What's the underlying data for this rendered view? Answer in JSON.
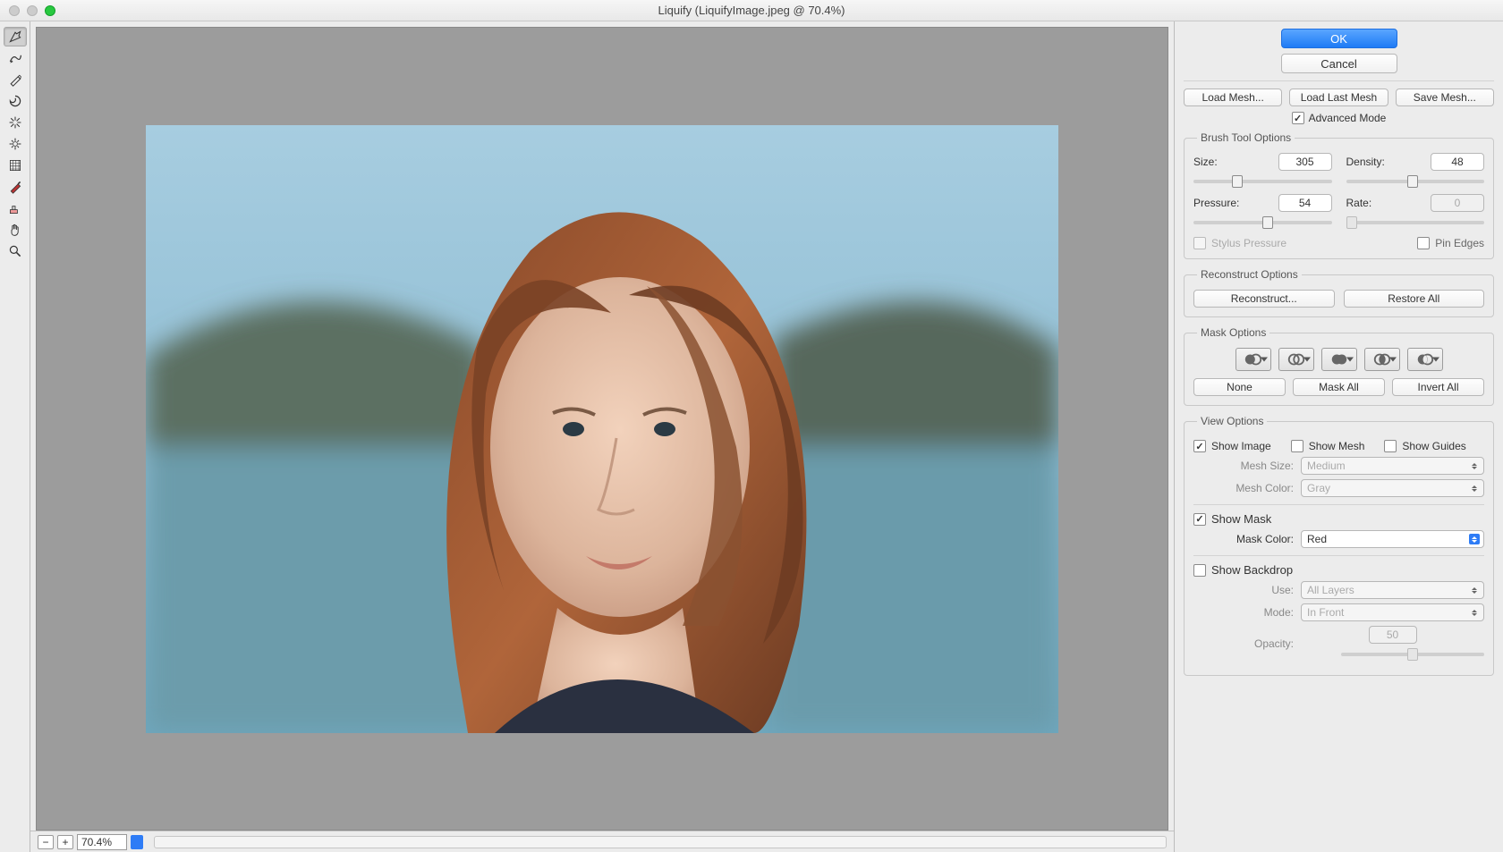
{
  "window": {
    "title": "Liquify (LiquifyImage.jpeg @ 70.4%)"
  },
  "tools": [
    {
      "name": "forward-warp-tool",
      "selected": true
    },
    {
      "name": "reconstruct-tool"
    },
    {
      "name": "smooth-tool"
    },
    {
      "name": "twirl-tool"
    },
    {
      "name": "pucker-tool"
    },
    {
      "name": "bloat-tool"
    },
    {
      "name": "push-left-tool"
    },
    {
      "name": "freeze-mask-tool"
    },
    {
      "name": "thaw-mask-tool"
    },
    {
      "name": "hand-tool"
    },
    {
      "name": "zoom-tool"
    }
  ],
  "status": {
    "zoom": "70.4%"
  },
  "actions": {
    "ok": "OK",
    "cancel": "Cancel"
  },
  "mesh": {
    "load": "Load Mesh...",
    "load_last": "Load Last Mesh",
    "save": "Save Mesh..."
  },
  "advanced": {
    "label": "Advanced Mode",
    "checked": true
  },
  "brush": {
    "legend": "Brush Tool Options",
    "size_label": "Size:",
    "size": "305",
    "size_pct": 30,
    "density_label": "Density:",
    "density": "48",
    "density_pct": 48,
    "pressure_label": "Pressure:",
    "pressure": "54",
    "pressure_pct": 54,
    "rate_label": "Rate:",
    "rate": "0",
    "rate_pct": 0,
    "rate_enabled": false,
    "stylus_label": "Stylus Pressure",
    "stylus_checked": false,
    "stylus_enabled": false,
    "pin_label": "Pin Edges",
    "pin_checked": false
  },
  "reconstruct": {
    "legend": "Reconstruct Options",
    "reconstruct": "Reconstruct...",
    "restore": "Restore All"
  },
  "mask": {
    "legend": "Mask Options",
    "none": "None",
    "mask_all": "Mask All",
    "invert_all": "Invert All"
  },
  "view": {
    "legend": "View Options",
    "show_image": {
      "label": "Show Image",
      "checked": true
    },
    "show_mesh": {
      "label": "Show Mesh",
      "checked": false
    },
    "show_guides": {
      "label": "Show Guides",
      "checked": false
    },
    "mesh_size_label": "Mesh Size:",
    "mesh_size": "Medium",
    "mesh_color_label": "Mesh Color:",
    "mesh_color": "Gray",
    "show_mask": {
      "label": "Show Mask",
      "checked": true
    },
    "mask_color_label": "Mask Color:",
    "mask_color": "Red",
    "show_backdrop": {
      "label": "Show Backdrop",
      "checked": false
    },
    "use_label": "Use:",
    "use": "All Layers",
    "mode_label": "Mode:",
    "mode": "In Front",
    "opacity_label": "Opacity:",
    "opacity": "50",
    "opacity_pct": 50
  }
}
